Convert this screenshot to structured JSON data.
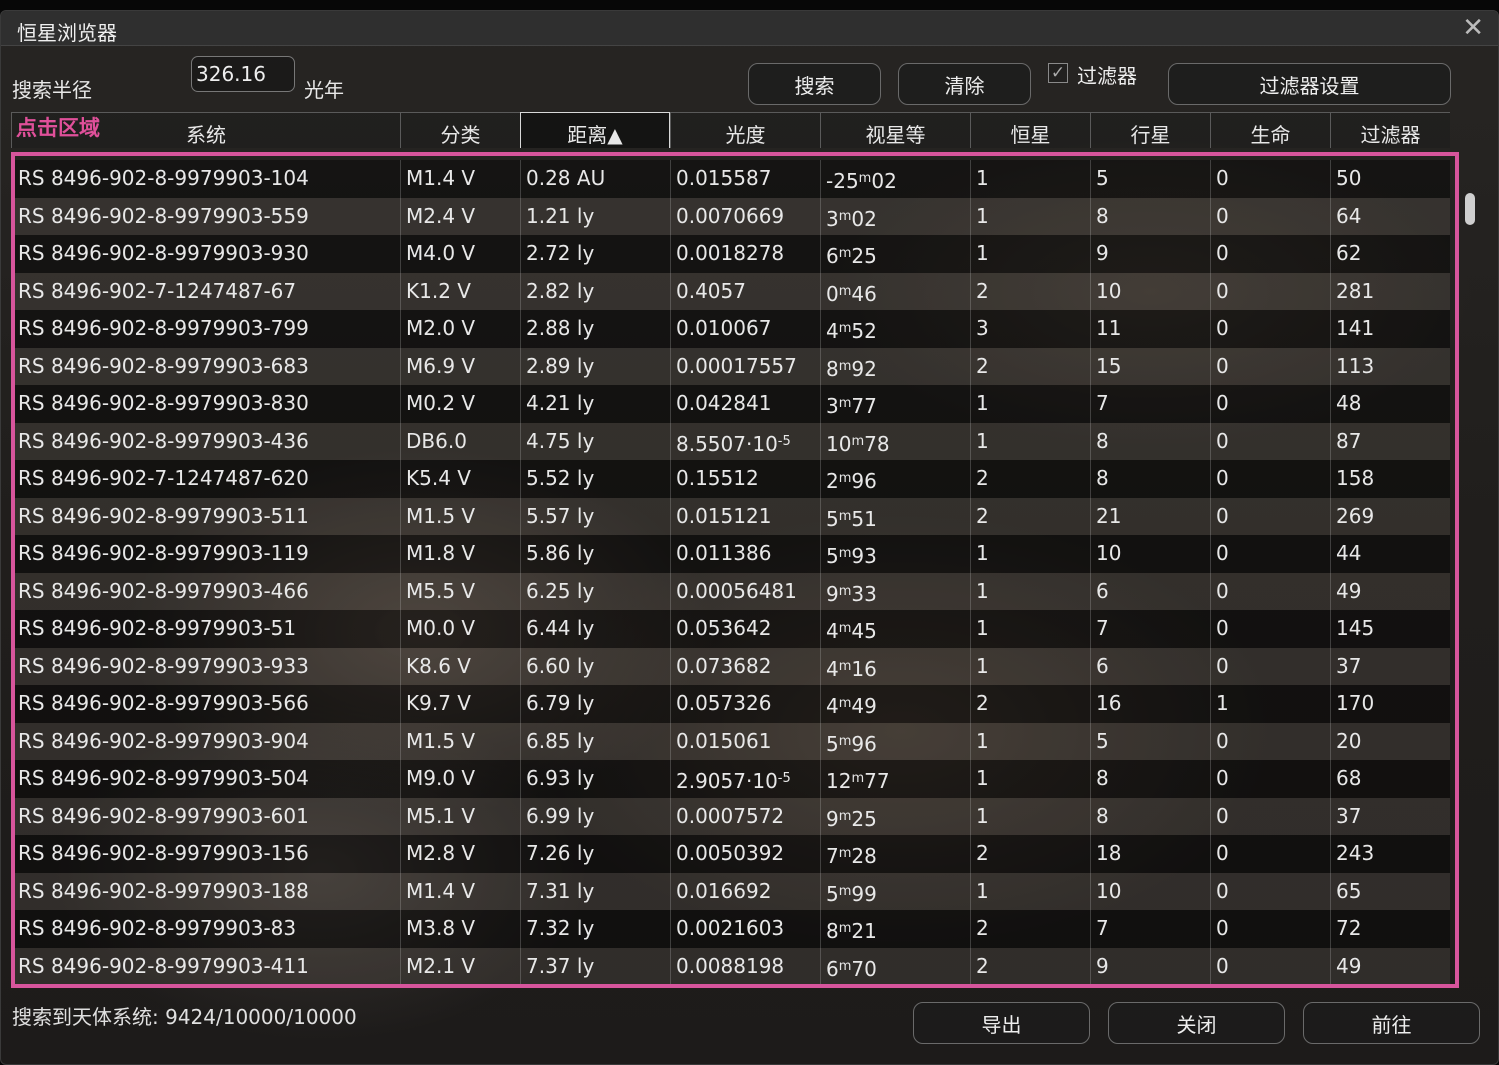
{
  "window": {
    "title": "恒星浏览器",
    "close_glyph": "✕"
  },
  "search": {
    "radius_label": "搜索半径",
    "radius_value": "326.16",
    "unit_label": "光年"
  },
  "toolbar": {
    "search_label": "搜索",
    "clear_label": "清除",
    "filter_checked": true,
    "filter_label": "过滤器",
    "filter_settings_label": "过滤器设置"
  },
  "annotation": {
    "click_area_label": "点击区域",
    "color": "#d7559c"
  },
  "table": {
    "headers": [
      "系统",
      "分类",
      "距离▲",
      "光度",
      "视星等",
      "恒星",
      "行星",
      "生命",
      "过滤器"
    ],
    "rows": [
      [
        "RS 8496-902-8-9979903-104",
        "M1.4 V",
        "0.28 AU",
        "0.015587",
        "-25m02",
        "1",
        "5",
        "0",
        "50"
      ],
      [
        "RS 8496-902-8-9979903-559",
        "M2.4 V",
        "1.21 ly",
        "0.0070669",
        "3m02",
        "1",
        "8",
        "0",
        "64"
      ],
      [
        "RS 8496-902-8-9979903-930",
        "M4.0 V",
        "2.72 ly",
        "0.0018278",
        "6m25",
        "1",
        "9",
        "0",
        "62"
      ],
      [
        "RS 8496-902-7-1247487-67",
        "K1.2 V",
        "2.82 ly",
        "0.4057",
        "0m46",
        "2",
        "10",
        "0",
        "281"
      ],
      [
        "RS 8496-902-8-9979903-799",
        "M2.0 V",
        "2.88 ly",
        "0.010067",
        "4m52",
        "3",
        "11",
        "0",
        "141"
      ],
      [
        "RS 8496-902-8-9979903-683",
        "M6.9 V",
        "2.89 ly",
        "0.00017557",
        "8m92",
        "2",
        "15",
        "0",
        "113"
      ],
      [
        "RS 8496-902-8-9979903-830",
        "M0.2 V",
        "4.21 ly",
        "0.042841",
        "3m77",
        "1",
        "7",
        "0",
        "48"
      ],
      [
        "RS 8496-902-8-9979903-436",
        "DB6.0",
        "4.75 ly",
        "8.5507·10-5",
        "10m78",
        "1",
        "8",
        "0",
        "87"
      ],
      [
        "RS 8496-902-7-1247487-620",
        "K5.4 V",
        "5.52 ly",
        "0.15512",
        "2m96",
        "2",
        "8",
        "0",
        "158"
      ],
      [
        "RS 8496-902-8-9979903-511",
        "M1.5 V",
        "5.57 ly",
        "0.015121",
        "5m51",
        "2",
        "21",
        "0",
        "269"
      ],
      [
        "RS 8496-902-8-9979903-119",
        "M1.8 V",
        "5.86 ly",
        "0.011386",
        "5m93",
        "1",
        "10",
        "0",
        "44"
      ],
      [
        "RS 8496-902-8-9979903-466",
        "M5.5 V",
        "6.25 ly",
        "0.00056481",
        "9m33",
        "1",
        "6",
        "0",
        "49"
      ],
      [
        "RS 8496-902-8-9979903-51",
        "M0.0 V",
        "6.44 ly",
        "0.053642",
        "4m45",
        "1",
        "7",
        "0",
        "145"
      ],
      [
        "RS 8496-902-8-9979903-933",
        "K8.6 V",
        "6.60 ly",
        "0.073682",
        "4m16",
        "1",
        "6",
        "0",
        "37"
      ],
      [
        "RS 8496-902-8-9979903-566",
        "K9.7 V",
        "6.79 ly",
        "0.057326",
        "4m49",
        "2",
        "16",
        "1",
        "170"
      ],
      [
        "RS 8496-902-8-9979903-904",
        "M1.5 V",
        "6.85 ly",
        "0.015061",
        "5m96",
        "1",
        "5",
        "0",
        "20"
      ],
      [
        "RS 8496-902-8-9979903-504",
        "M9.0 V",
        "6.93 ly",
        "2.9057·10-5",
        "12m77",
        "1",
        "8",
        "0",
        "68"
      ],
      [
        "RS 8496-902-8-9979903-601",
        "M5.1 V",
        "6.99 ly",
        "0.0007572",
        "9m25",
        "1",
        "8",
        "0",
        "37"
      ],
      [
        "RS 8496-902-8-9979903-156",
        "M2.8 V",
        "7.26 ly",
        "0.0050392",
        "7m28",
        "2",
        "18",
        "0",
        "243"
      ],
      [
        "RS 8496-902-8-9979903-188",
        "M1.4 V",
        "7.31 ly",
        "0.016692",
        "5m99",
        "1",
        "10",
        "0",
        "65"
      ],
      [
        "RS 8496-902-8-9979903-83",
        "M3.8 V",
        "7.32 ly",
        "0.0021603",
        "8m21",
        "2",
        "7",
        "0",
        "72"
      ],
      [
        "RS 8496-902-8-9979903-411",
        "M2.1 V",
        "7.37 ly",
        "0.0088198",
        "6m70",
        "2",
        "9",
        "0",
        "49"
      ]
    ]
  },
  "footer": {
    "status": "搜索到天体系统: 9424/10000/10000",
    "export_label": "导出",
    "close_label": "关闭",
    "goto_label": "前往"
  }
}
